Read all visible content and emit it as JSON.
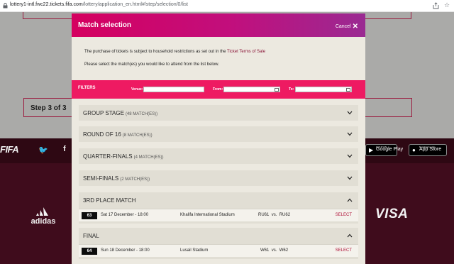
{
  "browser": {
    "url_host": "lottery1-intl.fwc22.tickets.fifa.com",
    "url_path": "/lottery/application_en.html#/step/selection/0/list"
  },
  "background": {
    "step_label": "Step 3 of 3",
    "footer": {
      "fifa_logo": "FIFA",
      "google_play_top": "GET IT ON",
      "google_play": "Google Play",
      "app_store_top": "Download on the",
      "app_store": "App Store",
      "sponsor_adidas": "adidas",
      "sponsor_visa": "VISA"
    }
  },
  "modal": {
    "title": "Match selection",
    "cancel_label": "Cancel",
    "intro_prefix": "The purchase of tickets is subject to household restrictions as set out in the",
    "intro_link": "Ticket Terms of Sale",
    "intro_line2": "Please select the match(es) you would like to attend from the list below.",
    "filters": {
      "title": "FILTERS",
      "venue_label": "Venue:",
      "from_label": "From:",
      "to_label": "To:",
      "venue_value": "",
      "from_value": "",
      "to_value": ""
    },
    "sections": [
      {
        "title": "GROUP STAGE",
        "count": "(48 MATCH(ES))",
        "expanded": false,
        "matches": []
      },
      {
        "title": "ROUND OF 16",
        "count": "(8 MATCH(ES))",
        "expanded": false,
        "matches": []
      },
      {
        "title": "QUARTER-FINALS",
        "count": "(4 MATCH(ES))",
        "expanded": false,
        "matches": []
      },
      {
        "title": "SEMI-FINALS",
        "count": "(2 MATCH(ES))",
        "expanded": false,
        "matches": []
      },
      {
        "title": "3RD PLACE MATCH",
        "count": "",
        "expanded": true,
        "matches": [
          {
            "number": "63",
            "datetime": "Sat 17 December - 18:00",
            "venue": "Khalifa International Stadium",
            "home": "RU61",
            "vs": "vs.",
            "away": "RU62",
            "select_label": "SELECT"
          }
        ]
      },
      {
        "title": "FINAL",
        "count": "",
        "expanded": true,
        "matches": [
          {
            "number": "64",
            "datetime": "Sun 18 December - 18:00",
            "venue": "Lusail Stadium",
            "home": "W61",
            "vs": "vs.",
            "away": "W62",
            "select_label": "SELECT"
          }
        ]
      }
    ]
  },
  "colors": {
    "header_gradient_start": "#d5005f",
    "header_gradient_end": "#9a2a92",
    "filters_bar": "#ee1a62",
    "link": "#8a1538",
    "select": "#b0143a"
  }
}
